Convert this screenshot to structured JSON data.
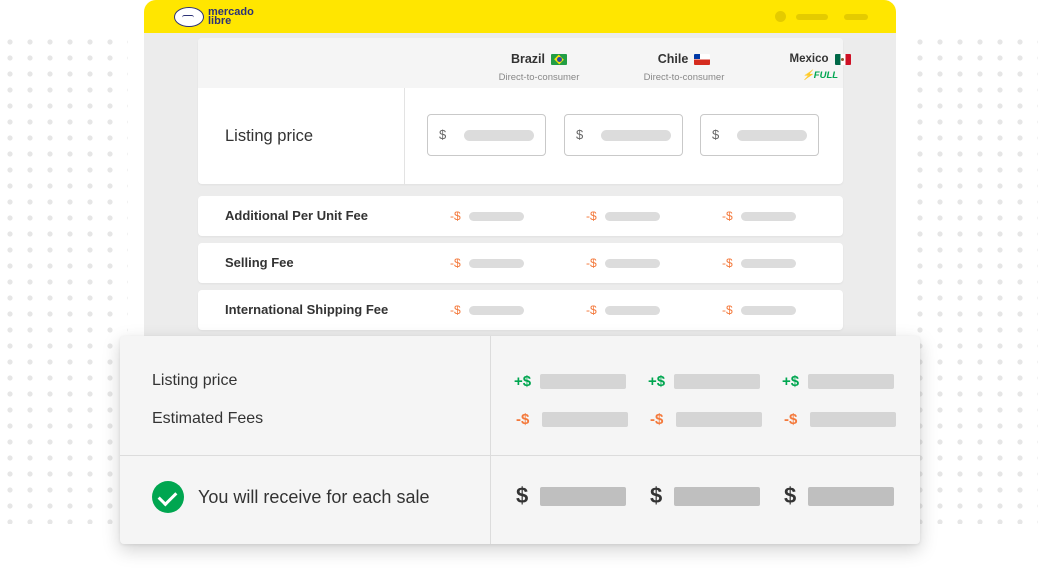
{
  "brand": {
    "name_line1": "mercado",
    "name_line2": "libre"
  },
  "countries": [
    {
      "name": "Brazil",
      "subtitle": "Direct-to-consumer",
      "flag": "brazil-flag"
    },
    {
      "name": "Chile",
      "subtitle": "Direct-to-consumer",
      "flag": "chile-flag"
    },
    {
      "name": "Mexico",
      "badge": "FULL",
      "flag": "mexico-flag"
    }
  ],
  "listing": {
    "label": "Listing price",
    "currency": "$"
  },
  "fees": [
    {
      "label": "Additional Per Unit Fee",
      "sign": "-$"
    },
    {
      "label": "Selling Fee",
      "sign": "-$"
    },
    {
      "label": "International Shipping Fee",
      "sign": "-$"
    }
  ],
  "summary": {
    "listing_label": "Listing price",
    "listing_sign": "+$",
    "fees_label": "Estimated Fees",
    "fees_sign": "-$",
    "receive_label": "You will receive for each sale",
    "receive_sign": "$"
  },
  "colors": {
    "brand_yellow": "#ffe600",
    "positive": "#00a650",
    "negative": "#f4793b"
  }
}
